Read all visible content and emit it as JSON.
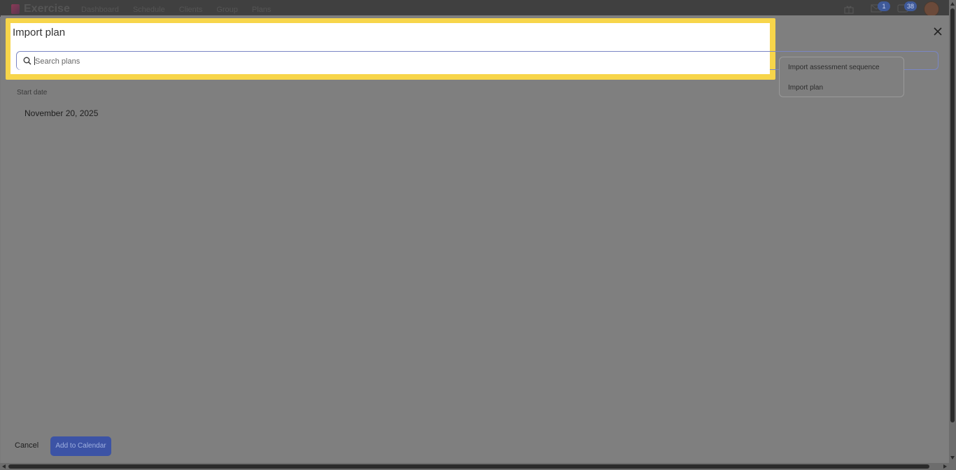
{
  "app": {
    "logo_text": "Exercise",
    "nav": [
      "Dashboard",
      "Schedule",
      "Clients",
      "Group",
      "Plans"
    ],
    "notifications": {
      "mail_count": "1",
      "chat_count": "38"
    }
  },
  "modal": {
    "title": "Import plan",
    "search": {
      "placeholder": "Search plans",
      "value": ""
    },
    "dropdown_items": [
      "Import assessment sequence",
      "Import plan"
    ],
    "start_date_label": "Start date",
    "start_date_value": "November 20, 2025",
    "cancel_label": "Cancel",
    "submit_label": "Add to Calendar"
  },
  "colors": {
    "highlight": "#f7d54a",
    "primary": "#3c53a5"
  }
}
